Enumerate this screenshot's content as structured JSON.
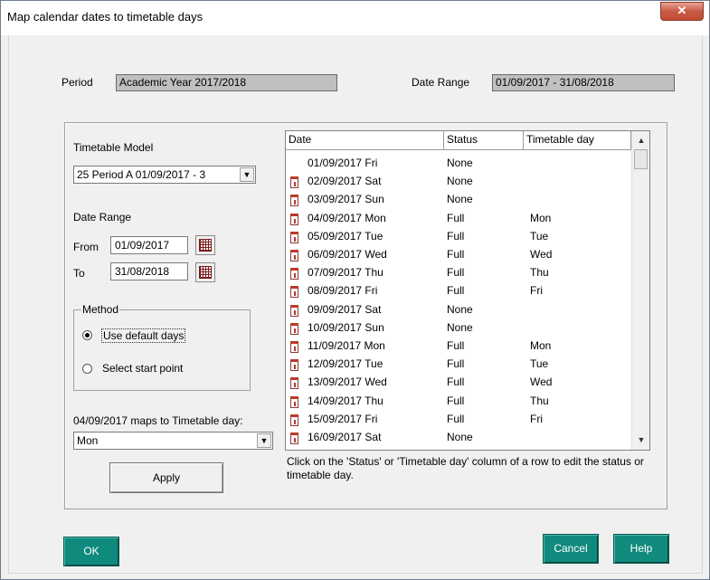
{
  "window": {
    "title": "Map calendar dates to timetable days",
    "close_glyph": "✕"
  },
  "period": {
    "label": "Period",
    "value": "Academic Year 2017/2018"
  },
  "date_range_top": {
    "label": "Date Range",
    "value": "01/09/2017 - 31/08/2018"
  },
  "left_panel": {
    "timetable_model_label": "Timetable Model",
    "timetable_model_value": "25 Period A 01/09/2017 - 3",
    "date_range_label": "Date Range",
    "from_label": "From",
    "from_value": "01/09/2017",
    "to_label": "To",
    "to_value": "31/08/2018",
    "method": {
      "title": "Method",
      "options": [
        {
          "label": "Use default days",
          "selected": true
        },
        {
          "label": "Select start point",
          "selected": false
        }
      ]
    },
    "maps_label": "04/09/2017  maps to Timetable day:",
    "maps_value": "Mon",
    "apply_label": "Apply"
  },
  "table": {
    "columns": [
      "Date",
      "Status",
      "Timetable day"
    ],
    "rows": [
      {
        "date": "01/09/2017 Fri",
        "status": "None",
        "day": "",
        "icon": false
      },
      {
        "date": "02/09/2017 Sat",
        "status": "None",
        "day": "",
        "icon": true
      },
      {
        "date": "03/09/2017 Sun",
        "status": "None",
        "day": "",
        "icon": true
      },
      {
        "date": "04/09/2017 Mon",
        "status": "Full",
        "day": "Mon",
        "icon": true
      },
      {
        "date": "05/09/2017 Tue",
        "status": "Full",
        "day": "Tue",
        "icon": true
      },
      {
        "date": "06/09/2017 Wed",
        "status": "Full",
        "day": "Wed",
        "icon": true
      },
      {
        "date": "07/09/2017 Thu",
        "status": "Full",
        "day": "Thu",
        "icon": true
      },
      {
        "date": "08/09/2017 Fri",
        "status": "Full",
        "day": "Fri",
        "icon": true
      },
      {
        "date": "09/09/2017 Sat",
        "status": "None",
        "day": "",
        "icon": true
      },
      {
        "date": "10/09/2017 Sun",
        "status": "None",
        "day": "",
        "icon": true
      },
      {
        "date": "11/09/2017 Mon",
        "status": "Full",
        "day": "Mon",
        "icon": true
      },
      {
        "date": "12/09/2017 Tue",
        "status": "Full",
        "day": "Tue",
        "icon": true
      },
      {
        "date": "13/09/2017 Wed",
        "status": "Full",
        "day": "Wed",
        "icon": true
      },
      {
        "date": "14/09/2017 Thu",
        "status": "Full",
        "day": "Thu",
        "icon": true
      },
      {
        "date": "15/09/2017 Fri",
        "status": "Full",
        "day": "Fri",
        "icon": true
      },
      {
        "date": "16/09/2017 Sat",
        "status": "None",
        "day": "",
        "icon": true
      }
    ],
    "hint": "Click on the 'Status' or 'Timetable day' column of a row to edit the status or timetable day."
  },
  "buttons": {
    "ok": "OK",
    "cancel": "Cancel",
    "help": "Help"
  },
  "colors": {
    "button_teal": "#0f8a7d",
    "readonly_field": "#c0c0c0"
  }
}
